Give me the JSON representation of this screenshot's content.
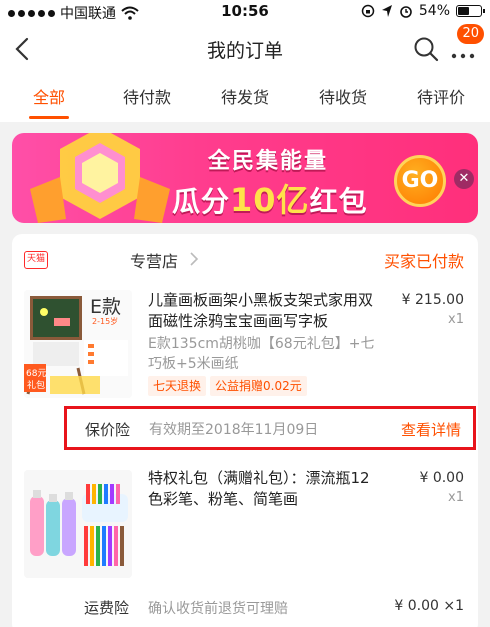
{
  "status_bar": {
    "carrier": "中国联通",
    "time": "10:56",
    "battery": "54%",
    "battery_level": 0.54
  },
  "nav": {
    "title": "我的订单",
    "badge": "20"
  },
  "tabs": [
    {
      "label": "全部"
    },
    {
      "label": "待付款"
    },
    {
      "label": "待发货"
    },
    {
      "label": "待收货"
    },
    {
      "label": "待评价"
    }
  ],
  "banner": {
    "line1": "全民集能量",
    "line2_pre": "瓜分",
    "line2_big": "10亿",
    "line2_post": "红包",
    "go": "GO"
  },
  "order": {
    "shop_badge": "天猫",
    "shop_name": "专营店",
    "status": "买家已付款",
    "items": [
      {
        "title": "儿童画板画架小黑板支架式家用双面磁性涂鸦宝宝画画写字板",
        "sku": "E款135cm胡桃咖【68元礼包】+七巧板+5米画纸",
        "price": "¥ 215.00",
        "qty": "x1",
        "tags": [
          "七天退换",
          "公益捐赠0.02元"
        ],
        "thumb": {
          "model": "E款",
          "age": "2-15岁",
          "gift": "68元",
          "gift2": "礼包"
        }
      },
      {
        "title": "特权礼包（满赠礼包）：漂流瓶12色彩笔、粉笔、简笔画",
        "price": "¥ 0.00",
        "qty": "x1"
      }
    ],
    "insurance": {
      "label": "保价险",
      "desc": "有效期至2018年11月09日",
      "link": "查看详情"
    },
    "freight": {
      "label": "运费险",
      "desc": "确认收货前退货可理赔",
      "price": "¥ 0.00 ×1"
    }
  }
}
